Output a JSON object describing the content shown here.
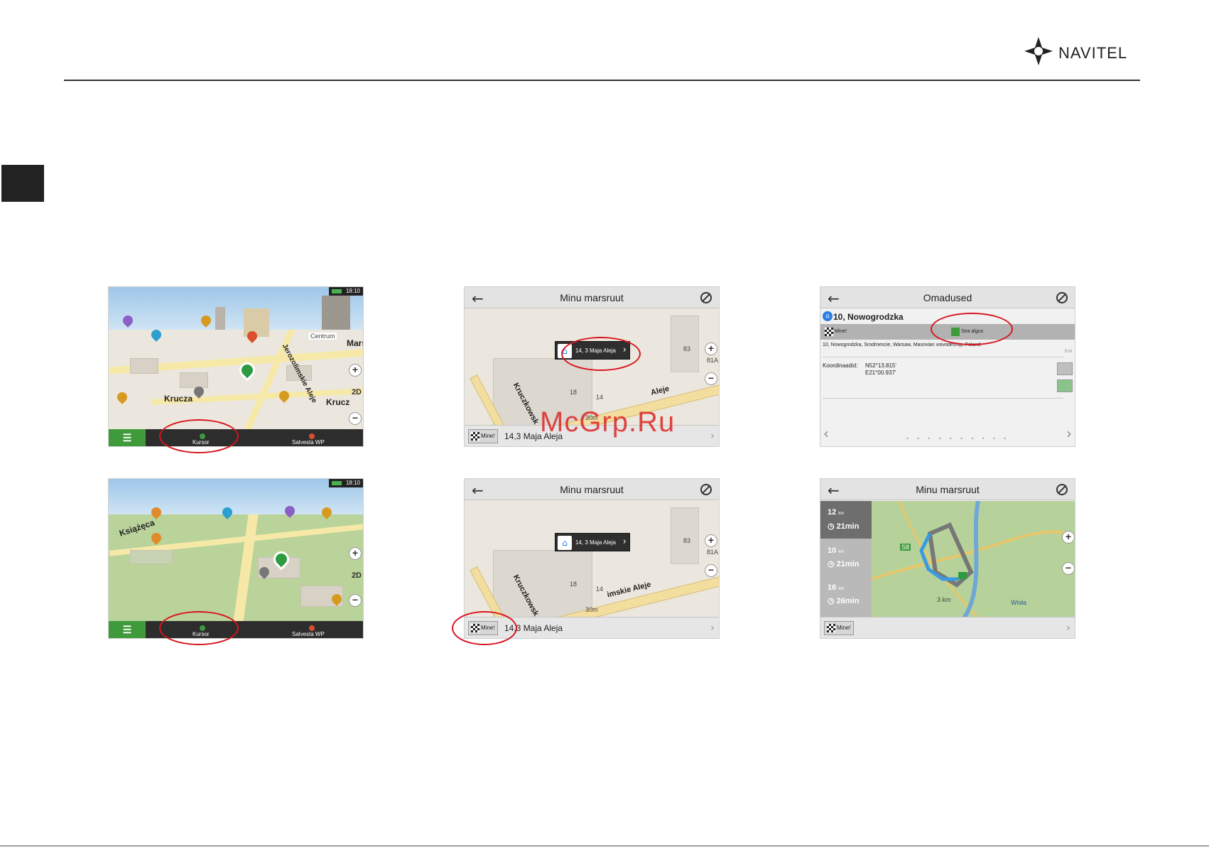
{
  "brand": {
    "logo_text": "NAVITEL"
  },
  "watermark": "McGrp.Ru",
  "icons": {
    "logo": "navitel-star-icon",
    "back": "back-arrow-icon",
    "no_route": "no-route-icon",
    "home": "home-icon",
    "checker_flag": "checkered-flag-icon",
    "zoom_in": "zoom-in-icon",
    "zoom_out": "zoom-out-icon",
    "chevron": "chevron-right-icon"
  },
  "colors": {
    "highlight": "#d8141e",
    "accent_green": "#3f9a3c",
    "watermark": "#dc1e1e"
  },
  "shot1": {
    "time": "18:10",
    "labels": [
      "Krucza",
      "Jerozolimskie Aleje",
      "Krucz",
      "Centrum",
      "Marsz"
    ],
    "view_mode": "2D",
    "nav": {
      "cursor": "Kursor",
      "save_wp": "Salvesta WP"
    }
  },
  "shot2": {
    "time": "18:10",
    "labels": [
      "Książęca"
    ],
    "view_mode": "2D",
    "nav": {
      "cursor": "Kursor",
      "save_wp": "Salvesta WP"
    }
  },
  "shot3": {
    "title": "Minu marsruut",
    "popup_address": "14, 3 Maja Aleja",
    "street": "Kruczkowsk",
    "street2": "Aleje",
    "numbers": [
      "18",
      "14",
      "83",
      "81A"
    ],
    "scale": "30m",
    "go_label": "Mine!",
    "bottom_address": "14,3 Maja Aleja"
  },
  "shot4": {
    "title": "Minu marsruut",
    "popup_address": "14, 3 Maja Aleja",
    "street": "Kruczkowsk",
    "street2": "imskie Aleje",
    "numbers": [
      "18",
      "14",
      "83",
      "81A"
    ],
    "scale": "30m",
    "go_label": "Mine!",
    "bottom_address": "14,3 Maja Aleja"
  },
  "shot5": {
    "title": "Omadused",
    "name": "10, Nowogrodzka",
    "go_label": "Mine!",
    "set_start_label": "Sea algus",
    "address": "10, Nowogrodzka, Srodmescie, Warsaw, Masovian voivodeship, Poland",
    "distance": "0 m",
    "coords_label": "Koordinaadid:",
    "lat": "N52°13.815'",
    "lon": "E21°00.937'",
    "dots": "• • • • • • • • • •"
  },
  "shot6": {
    "title": "Minu marsruut",
    "routes": [
      {
        "distance": "12",
        "time": "21min"
      },
      {
        "distance": "10",
        "time": "21min"
      },
      {
        "distance": "16",
        "time": "26min"
      }
    ],
    "distance_unit": "km",
    "road_label": "S8",
    "scale": "3 km",
    "river": "Wisła",
    "go_label": "Mine!"
  }
}
